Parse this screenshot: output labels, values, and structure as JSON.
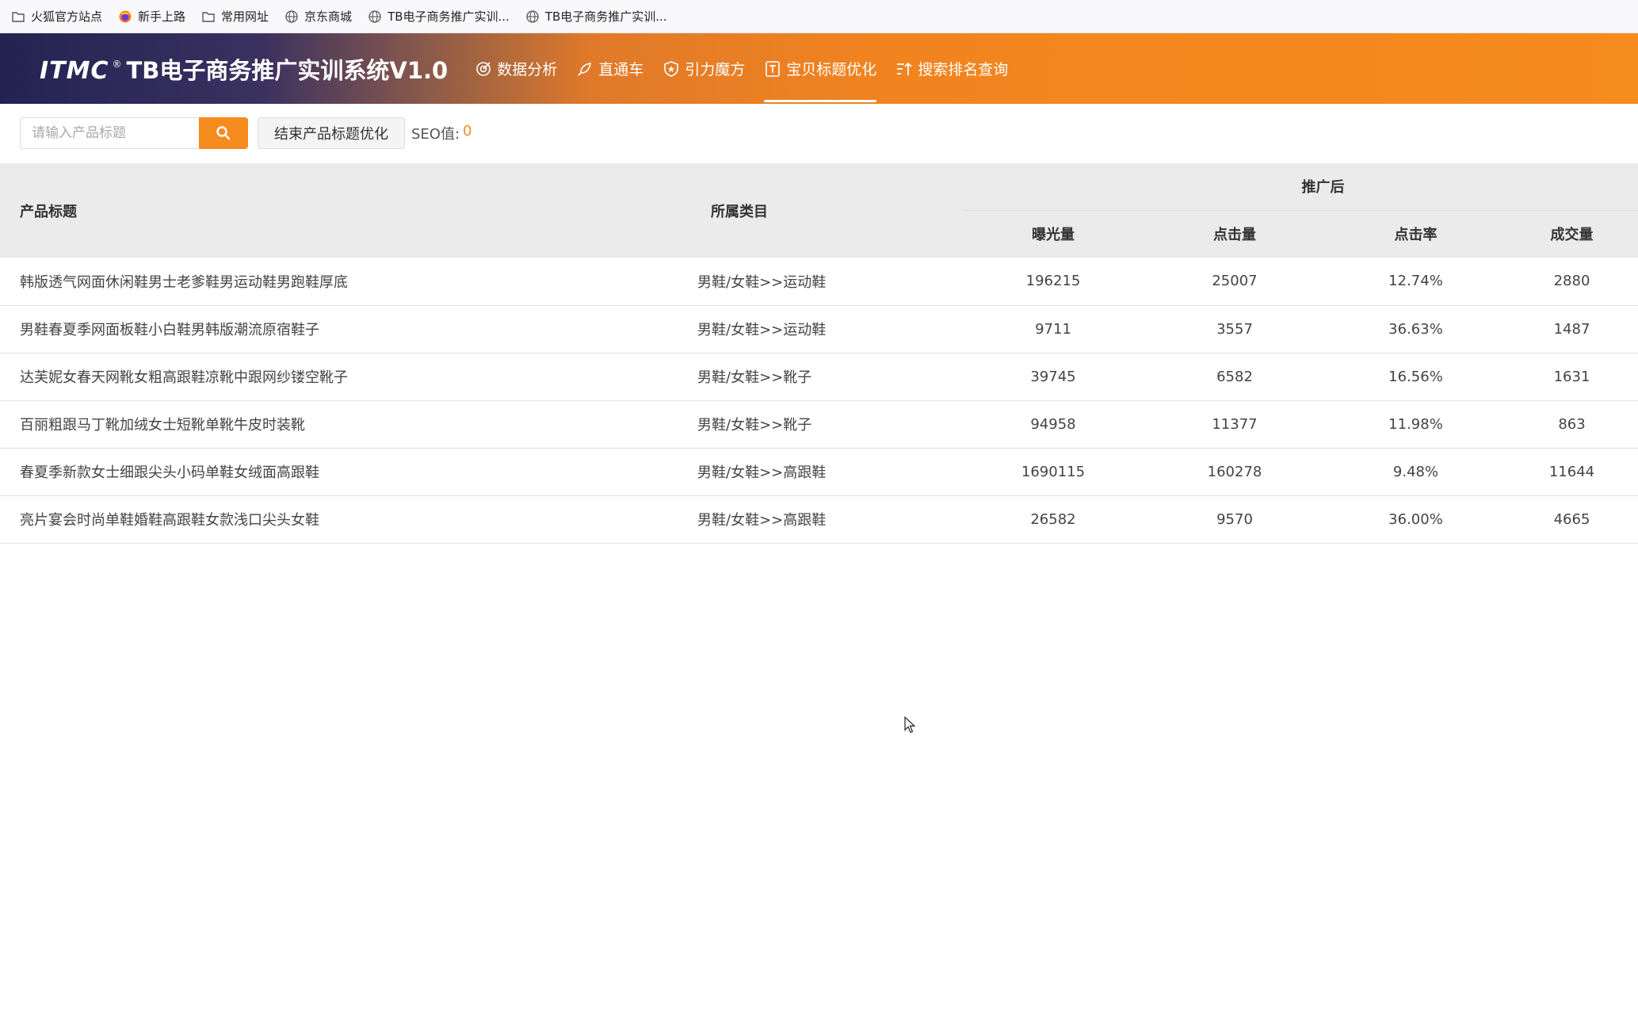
{
  "bookmarks": [
    {
      "label": "火狐官方站点",
      "icon": "folder-icon"
    },
    {
      "label": "新手上路",
      "icon": "firefox-icon"
    },
    {
      "label": "常用网址",
      "icon": "folder-icon"
    },
    {
      "label": "京东商城",
      "icon": "globe-icon"
    },
    {
      "label": "TB电子商务推广实训...",
      "icon": "globe-icon"
    },
    {
      "label": "TB电子商务推广实训...",
      "icon": "globe-icon"
    }
  ],
  "header": {
    "brand_mark": "ITMC",
    "brand_reg": "®",
    "brand_title": "TB电子商务推广实训系统V1.0",
    "nav": [
      {
        "label": "数据分析",
        "icon": "target-icon"
      },
      {
        "label": "直通车",
        "icon": "rocket-icon"
      },
      {
        "label": "引力魔方",
        "icon": "shield-icon"
      },
      {
        "label": "宝贝标题优化",
        "icon": "title-icon"
      },
      {
        "label": "搜索排名查询",
        "icon": "sort-icon"
      }
    ],
    "active_nav": "宝贝标题优化"
  },
  "toolbar": {
    "search_placeholder": "请输入产品标题",
    "end_button": "结束产品标题优化",
    "seo_label": "SEO值:",
    "seo_value": "0"
  },
  "table": {
    "headers": {
      "title": "产品标题",
      "category": "所属类目",
      "group": "推广后",
      "impressions": "曝光量",
      "clicks": "点击量",
      "ctr": "点击率",
      "deals": "成交量"
    },
    "rows": [
      {
        "title": "韩版透气网面休闲鞋男士老爹鞋男运动鞋男跑鞋厚底",
        "category": "男鞋/女鞋>>运动鞋",
        "impressions": "196215",
        "clicks": "25007",
        "ctr": "12.74%",
        "deals": "2880"
      },
      {
        "title": "男鞋春夏季网面板鞋小白鞋男韩版潮流原宿鞋子",
        "category": "男鞋/女鞋>>运动鞋",
        "impressions": "9711",
        "clicks": "3557",
        "ctr": "36.63%",
        "deals": "1487"
      },
      {
        "title": "达芙妮女春天网靴女粗高跟鞋凉靴中跟网纱镂空靴子",
        "category": "男鞋/女鞋>>靴子",
        "impressions": "39745",
        "clicks": "6582",
        "ctr": "16.56%",
        "deals": "1631"
      },
      {
        "title": "百丽粗跟马丁靴加绒女士短靴单靴牛皮时装靴",
        "category": "男鞋/女鞋>>靴子",
        "impressions": "94958",
        "clicks": "11377",
        "ctr": "11.98%",
        "deals": "863"
      },
      {
        "title": "春夏季新款女士细跟尖头小码单鞋女绒面高跟鞋",
        "category": "男鞋/女鞋>>高跟鞋",
        "impressions": "1690115",
        "clicks": "160278",
        "ctr": "9.48%",
        "deals": "11644"
      },
      {
        "title": "亮片宴会时尚单鞋婚鞋高跟鞋女款浅口尖头女鞋",
        "category": "男鞋/女鞋>>高跟鞋",
        "impressions": "26582",
        "clicks": "9570",
        "ctr": "36.00%",
        "deals": "4665"
      }
    ]
  },
  "colors": {
    "accent": "#f68b1e",
    "header_dark": "#232352"
  }
}
